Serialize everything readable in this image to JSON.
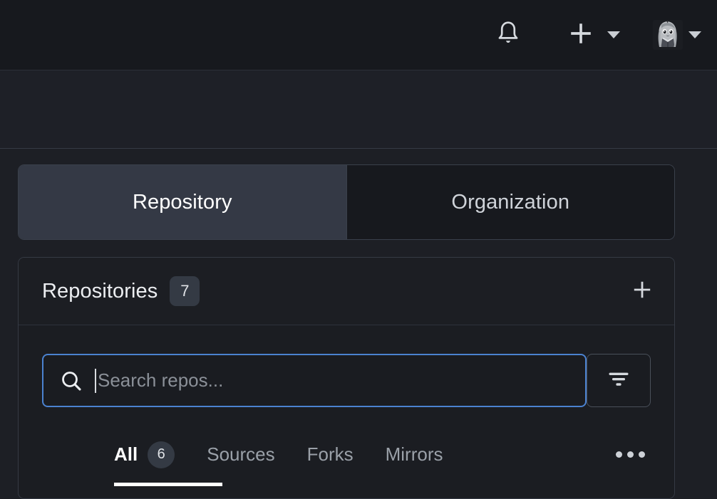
{
  "navbar": {
    "notifications_icon": "bell-icon",
    "create_icon": "plus-icon",
    "create_caret_icon": "chevron-down-icon",
    "avatar_icon": "user-avatar",
    "avatar_caret_icon": "chevron-down-icon"
  },
  "segmented_control": {
    "options": [
      {
        "label": "Repository",
        "active": true
      },
      {
        "label": "Organization",
        "active": false
      }
    ]
  },
  "repositories_card": {
    "title": "Repositories",
    "count": "7",
    "add_icon": "plus-icon",
    "search": {
      "value": "",
      "placeholder": "Search repos...",
      "icon": "search-icon",
      "focused": true
    },
    "filter_button_icon": "filter-icon",
    "tabs": [
      {
        "label": "All",
        "badge": "6",
        "active": true
      },
      {
        "label": "Sources",
        "badge": "",
        "active": false
      },
      {
        "label": "Forks",
        "badge": "",
        "active": false
      },
      {
        "label": "Mirrors",
        "badge": "",
        "active": false
      }
    ],
    "overflow_icon": "ellipsis-icon"
  },
  "colors": {
    "page_background": "#1d1f25",
    "navbar_background": "#17191e",
    "card_background": "#1c1e23",
    "active_segment": "#343945",
    "focus_border": "#4b82d0",
    "accent_text": "#ffffff",
    "muted_text": "#9aa0a8",
    "border": "#353a44"
  }
}
